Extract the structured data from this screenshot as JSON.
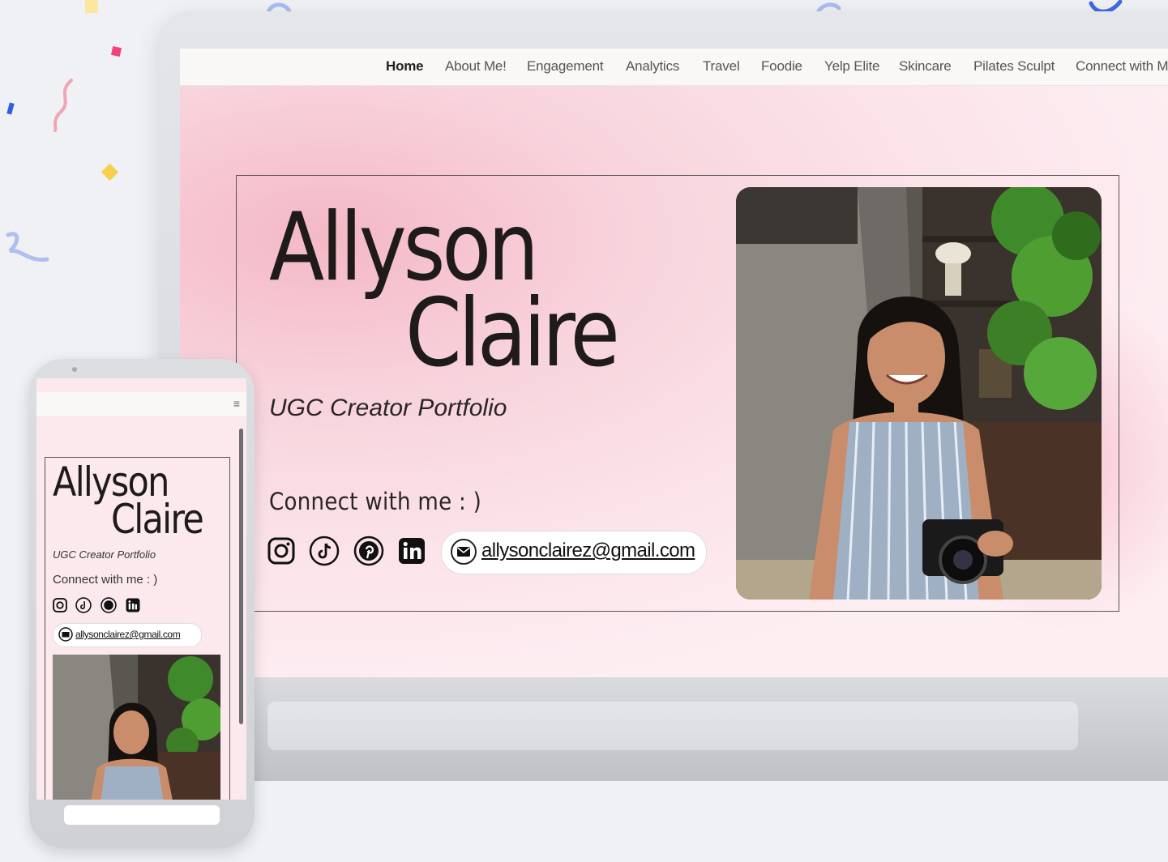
{
  "nav": {
    "items": [
      "Home",
      "About Me!",
      "Engagement",
      "Analytics",
      "Travel",
      "Foodie",
      "Yelp Elite",
      "Skincare",
      "Pilates Sculpt",
      "Connect with M"
    ],
    "active": "Home"
  },
  "hero": {
    "first_name": "Allyson",
    "last_name": "Claire",
    "subtitle": "UGC Creator Portfolio",
    "connect_label": "Connect with me : )",
    "email": "allysonclairez@gmail.com",
    "socials": [
      "instagram-icon",
      "tiktok-icon",
      "pinterest-icon",
      "linkedin-icon"
    ]
  },
  "phone": {
    "first_name": "Allyson",
    "last_name": "Claire",
    "subtitle": "UGC Creator Portfolio",
    "connect_label": "Connect with me : )",
    "email": "allysonclairez@gmail.com",
    "menu_icon": "hamburger-icon"
  },
  "colors": {
    "background": "#eff1f5",
    "hero_pink": "#fbe6ec",
    "accent_pink": "#f4b8c6",
    "text_dark": "#1f1b1b"
  }
}
